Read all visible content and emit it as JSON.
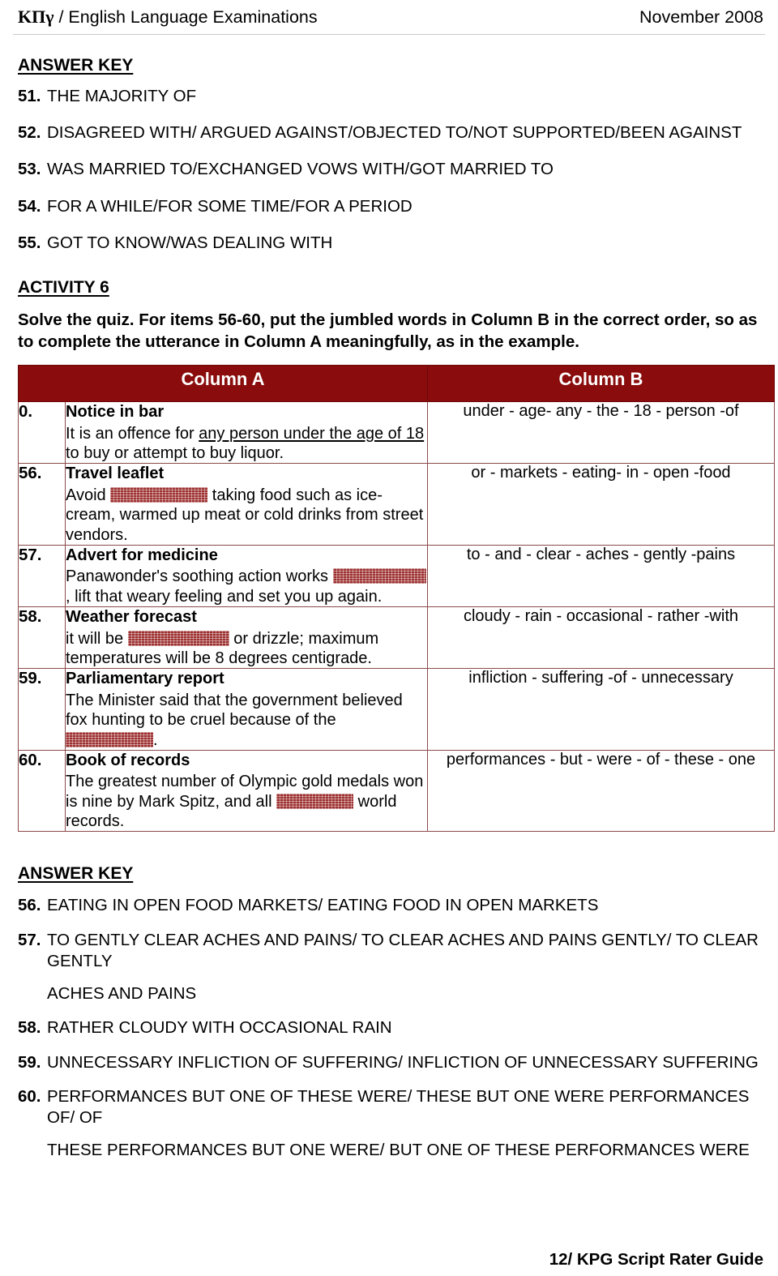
{
  "header": {
    "left_greek": "ΚΠγ",
    "left_rest": " / English Language Examinations",
    "right": "November 2008"
  },
  "answer_key_top": {
    "title": "ANSWER KEY",
    "items": [
      {
        "num": "51.",
        "text": "THE MAJORITY OF"
      },
      {
        "num": "52.",
        "text": "DISAGREED WITH/ ARGUED AGAINST/OBJECTED TO/NOT SUPPORTED/BEEN AGAINST"
      },
      {
        "num": "53.",
        "text": "WAS MARRIED TO/EXCHANGED VOWS WITH/GOT MARRIED TO"
      },
      {
        "num": "54.",
        "text": "FOR A WHILE/FOR SOME TIME/FOR A PERIOD"
      },
      {
        "num": "55.",
        "text": "GOT TO KNOW/WAS DEALING WITH"
      }
    ]
  },
  "activity": {
    "title": "ACTIVITY 6",
    "instructions": "Solve the quiz. For items 56-60, put the jumbled words in Column B in the correct order, so as to complete the utterance in Column A meaningfully, as in the example."
  },
  "table": {
    "header_color": "#8a0c0c",
    "border_color": "#8c4a4a",
    "columns": [
      "Column A",
      "Column B"
    ],
    "rows": [
      {
        "num": "0.",
        "subtitle": "Notice in bar",
        "body_pre": "It is an offence for ",
        "body_underlined": "any person under the age of 18",
        "body_post": " to buy or attempt to buy liquor.",
        "column_b": "under - age- any - the - 18 - person -of"
      },
      {
        "num": "56.",
        "subtitle": "Travel leaflet",
        "body_pre": "Avoid ",
        "body_post": " taking food such as ice-cream, warmed up meat or cold drinks from street vendors.",
        "column_b": "or - markets - eating- in - open -food"
      },
      {
        "num": "57.",
        "subtitle": "Advert for medicine",
        "body_pre": "Panawonder's soothing action works ",
        "body_post": ", lift that weary feeling and set you up again.",
        "column_b": "to - and - clear - aches - gently -pains"
      },
      {
        "num": "58.",
        "subtitle": "Weather forecast",
        "body_pre": "it will be ",
        "body_post": " or drizzle; maximum temperatures will be 8 degrees centigrade.",
        "column_b": "cloudy - rain - occasional - rather -with"
      },
      {
        "num": "59.",
        "subtitle": "Parliamentary report",
        "body_pre": "The Minister said that the government believed fox hunting to be cruel because of the ",
        "body_post": ".",
        "column_b": "infliction - suffering -of - unnecessary"
      },
      {
        "num": "60.",
        "subtitle": "Book of records",
        "body_pre": "The greatest number of Olympic gold medals won is nine by Mark Spitz, and all ",
        "body_post": " world records.",
        "column_b": "performances - but - were - of - these - one"
      }
    ]
  },
  "answer_key_bottom": {
    "title": "ANSWER KEY",
    "items": [
      {
        "num": "56.",
        "text": "EATING IN OPEN FOOD MARKETS/ EATING FOOD IN OPEN MARKETS",
        "cont": ""
      },
      {
        "num": "57.",
        "text": "TO GENTLY CLEAR ACHES AND PAINS/ TO CLEAR ACHES AND PAINS GENTLY/ TO CLEAR GENTLY",
        "cont": "ACHES AND PAINS"
      },
      {
        "num": "58.",
        "text": "RATHER CLOUDY WITH OCCASIONAL RAIN",
        "cont": ""
      },
      {
        "num": "59.",
        "text": "UNNECESSARY INFLICTION OF SUFFERING/ INFLICTION OF UNNECESSARY SUFFERING",
        "cont": ""
      },
      {
        "num": "60.",
        "text": "PERFORMANCES BUT ONE OF THESE WERE/ THESE BUT ONE WERE PERFORMANCES OF/ OF",
        "cont": "THESE PERFORMANCES BUT ONE WERE/ BUT ONE OF THESE PERFORMANCES WERE"
      }
    ]
  },
  "footer": {
    "text": "12/ KPG Script Rater Guide"
  }
}
